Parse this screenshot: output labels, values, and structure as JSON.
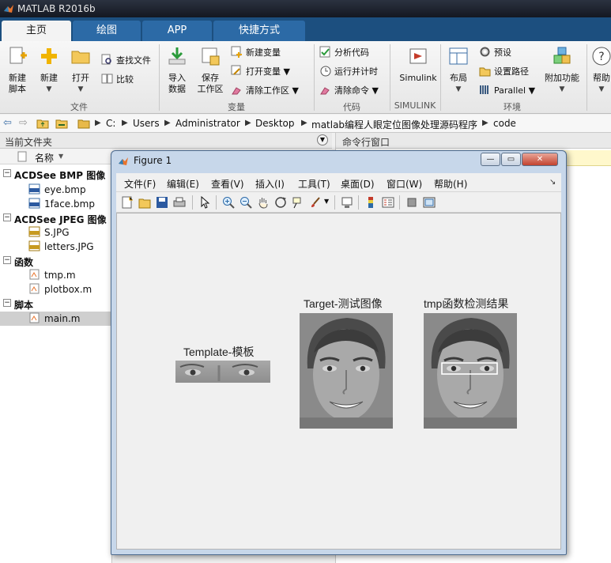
{
  "app": {
    "title": "MATLAB R2016b"
  },
  "tabs": [
    "主页",
    "绘图",
    "APP",
    "快捷方式"
  ],
  "ribbon": {
    "file_group": {
      "label": "文件",
      "new_script": "新建\n脚本",
      "new": "新建",
      "open": "打开",
      "find_files": "查找文件",
      "compare": "比较"
    },
    "variable_group": {
      "label": "变量",
      "import": "导入\n数据",
      "save_ws": "保存\n工作区",
      "new_var": "新建变量",
      "open_var": "打开变量",
      "clear_ws": "清除工作区"
    },
    "code_group": {
      "label": "代码",
      "analyze": "分析代码",
      "run_time": "运行并计时",
      "clear_cmd": "清除命令"
    },
    "simulink_group": {
      "label": "SIMULINK",
      "simulink": "Simulink"
    },
    "env_group": {
      "label": "环境",
      "layout": "布局",
      "prefs": "预设",
      "set_path": "设置路径",
      "parallel": "Parallel",
      "addons": "附加功能",
      "help": "帮助"
    }
  },
  "address": {
    "parts": [
      "C:",
      "Users",
      "Administrator",
      "Desktop",
      "matlab编程人眼定位图像处理源码程序",
      "code"
    ]
  },
  "current_folder": {
    "title": "当前文件夹",
    "column": "名称",
    "groups": [
      {
        "name": "ACDSee BMP 图像",
        "files": [
          "eye.bmp",
          "1face.bmp"
        ]
      },
      {
        "name": "ACDSee JPEG 图像",
        "files": [
          "S.JPG",
          "letters.JPG"
        ]
      },
      {
        "name": "函数",
        "files": [
          "tmp.m",
          "plotbox.m"
        ]
      },
      {
        "name": "脚本",
        "files": [
          "main.m"
        ]
      }
    ]
  },
  "command_window": {
    "title": "命令行窗口"
  },
  "figure": {
    "title": "Figure 1",
    "menus": [
      "文件(F)",
      "编辑(E)",
      "查看(V)",
      "插入(I)",
      "工具(T)",
      "桌面(D)",
      "窗口(W)",
      "帮助(H)"
    ],
    "axes": [
      {
        "title": "Template-模板"
      },
      {
        "title": "Target-测试图像"
      },
      {
        "title": "tmp函数检测结果"
      }
    ]
  },
  "colors": {
    "title_bar": "#1c222c",
    "tab_strip": "#1c4f7f",
    "accent": "#2c6aa6"
  }
}
